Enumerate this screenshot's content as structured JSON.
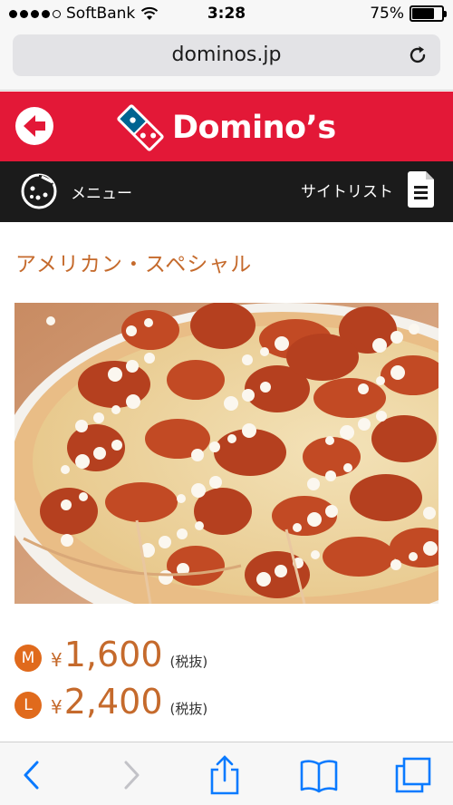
{
  "status_bar": {
    "carrier": "SoftBank",
    "time": "3:28",
    "battery_percent": "75%",
    "battery_level": 0.75
  },
  "browser": {
    "url": "dominos.jp"
  },
  "brand": {
    "logo_text": "Domino’s",
    "color_red": "#e31837",
    "color_blue": "#006491"
  },
  "nav": {
    "menu_label": "メニュー",
    "sitelist_label": "サイトリスト"
  },
  "product": {
    "name": "アメリカン・スペシャル",
    "prices": [
      {
        "size": "M",
        "currency": "¥",
        "amount": "1,600",
        "tax_note": "(税抜)"
      },
      {
        "size": "L",
        "currency": "¥",
        "amount": "2,400",
        "tax_note": "(税抜)"
      }
    ],
    "accent_color": "#c56a2c"
  },
  "toolbar": {
    "icons": [
      "back-icon",
      "forward-icon",
      "share-icon",
      "bookmarks-icon",
      "tabs-icon"
    ]
  }
}
